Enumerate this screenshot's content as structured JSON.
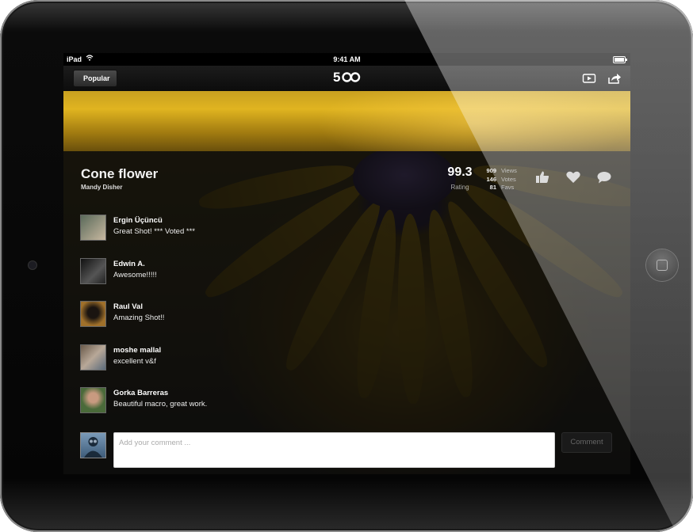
{
  "status": {
    "carrier": "iPad",
    "time": "9:41 AM"
  },
  "nav": {
    "back_label": "Popular",
    "logo": "500"
  },
  "photo": {
    "title": "Cone flower",
    "author": "Mandy Disher",
    "rating": "99.3",
    "rating_label": "Rating"
  },
  "stats": [
    {
      "value": "909",
      "label": "Views"
    },
    {
      "value": "146",
      "label": "Votes"
    },
    {
      "value": "81",
      "label": "Favs"
    }
  ],
  "comments": [
    {
      "name": "Ergin Üçüncü",
      "text": "Great Shot! *** Voted ***",
      "avatar_color": "#7a8a7a"
    },
    {
      "name": "Edwin A.",
      "text": "Awesome!!!!!",
      "avatar_color": "#2a2a2a"
    },
    {
      "name": "Raul Val",
      "text": "Amazing Shot!!",
      "avatar_color": "#6a4a2a"
    },
    {
      "name": "moshe mallal",
      "text": "excellent v&f",
      "avatar_color": "#8a7a6a"
    },
    {
      "name": "Gorka Barreras",
      "text": "Beautiful macro, great work.",
      "avatar_color": "#6a8a6a"
    }
  ],
  "composer": {
    "placeholder": "Add your comment ...",
    "button_label": "Comment"
  }
}
